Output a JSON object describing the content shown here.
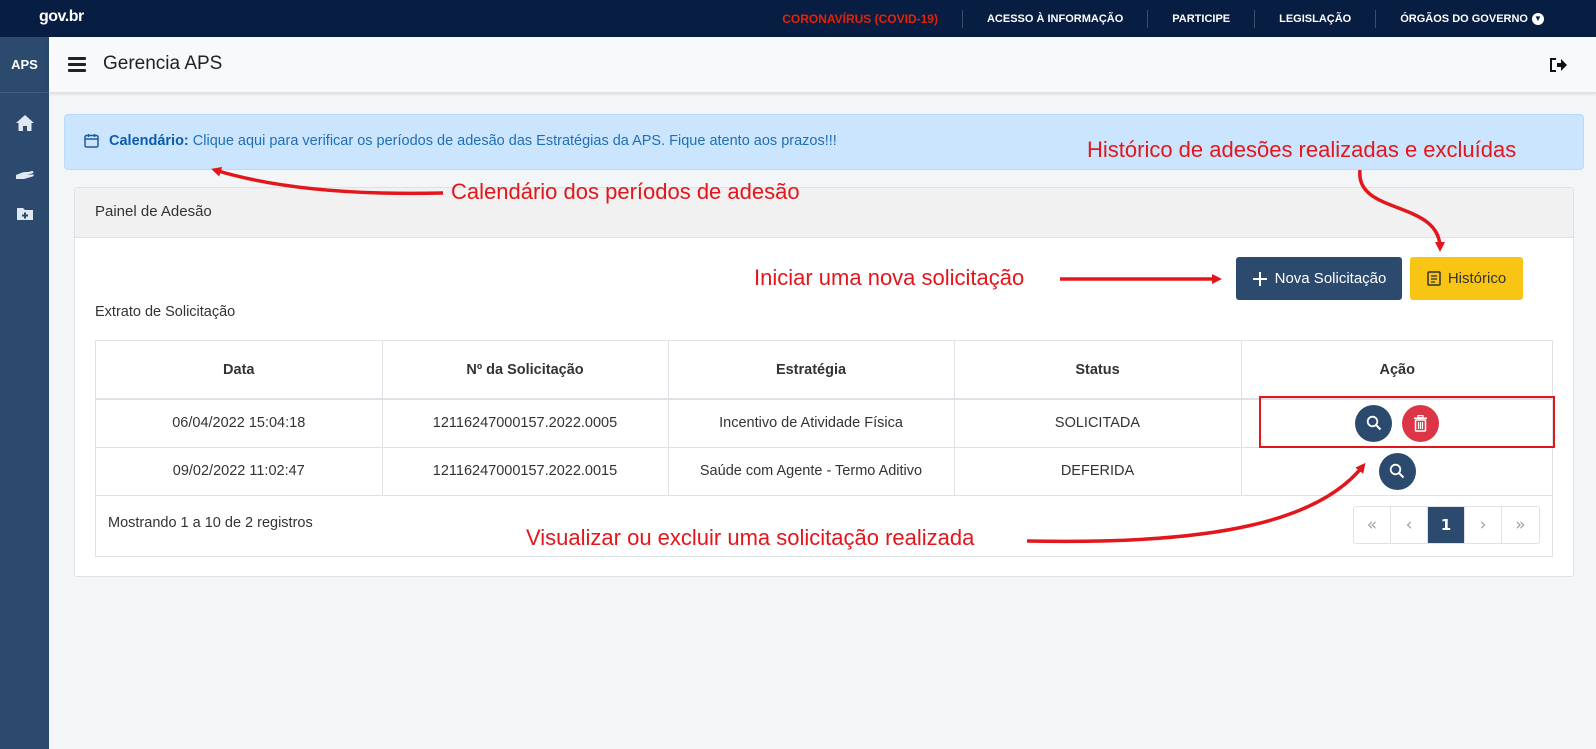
{
  "govbar": {
    "logo": "gov.br",
    "links": [
      "CORONAVÍRUS (COVID-19)",
      "ACESSO À INFORMAÇÃO",
      "PARTICIPE",
      "LEGISLAÇÃO",
      "ÓRGÃOS DO GOVERNO"
    ]
  },
  "sidebar": {
    "brand": "APS",
    "icons": [
      "home-icon",
      "hand-icon",
      "folder-plus-icon"
    ]
  },
  "header": {
    "title": "Gerencia APS"
  },
  "alert": {
    "label": "Calendário:",
    "text": " Clique aqui para verificar os períodos de adesão das Estratégias da APS. Fique atento aos prazos!!!"
  },
  "panel": {
    "title": "Painel de Adesão",
    "nova_label": "Nova Solicitação",
    "historico_label": "Histórico",
    "extrato": "Extrato de Solicitação"
  },
  "table": {
    "columns": [
      "Data",
      "Nº da Solicitação",
      "Estratégia",
      "Status",
      "Ação"
    ],
    "rows": [
      [
        "06/04/2022 15:04:18",
        "12116247000157.2022.0005",
        "Incentivo de Atividade Física",
        "SOLICITADA"
      ],
      [
        "09/02/2022 11:02:47",
        "12116247000157.2022.0015",
        "Saúde com Agente - Termo Aditivo",
        "DEFERIDA"
      ]
    ],
    "footer": "Mostrando 1 a 10 de 2 registros",
    "pagination": {
      "first": "«",
      "prev": "‹",
      "current": "1",
      "next": "›",
      "last": "»"
    }
  },
  "annotations": {
    "calendar": "Calendário dos períodos de adesão",
    "history": "Histórico de adesões realizadas e excluídas",
    "new": "Iniciar uma nova solicitação",
    "view": "Visualizar ou excluir uma solicitação realizada"
  },
  "colors": {
    "govbar": "#071d41",
    "sidebar": "#2c4a6e",
    "accent": "#2c4a6e",
    "warning": "#f8c515",
    "danger": "#dc3545",
    "annotation": "#e3161b"
  }
}
